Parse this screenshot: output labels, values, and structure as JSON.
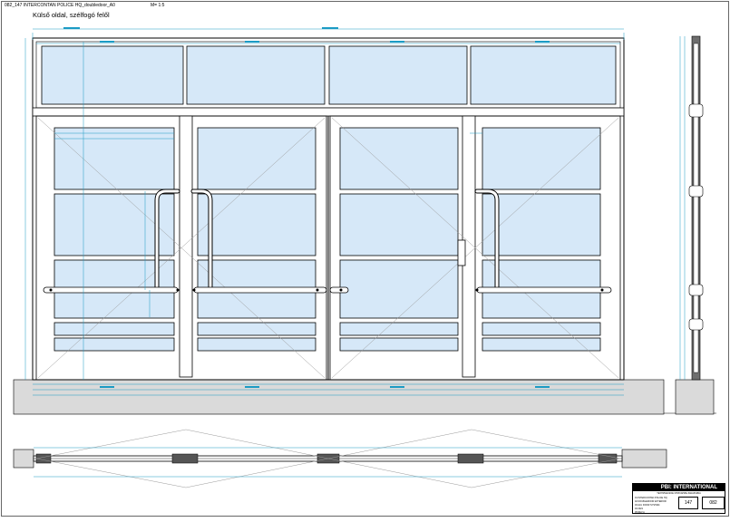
{
  "header": {
    "drawing_id": "082_147  INTERCONTAN POLICE HQ_doubledoor_A0",
    "scale": "M= 1:5"
  },
  "view_title": "Külső oldal, szélfogó felől",
  "title_block": {
    "firm": "PBI: INTERNATIONAL",
    "subtitle": "ТЕХНИЧЕСКОЕ ОПИСАНИЕ ЗАКАЗЧИКА",
    "drawing_number": "147",
    "project_number": "082",
    "rows": [
      "01  INTERCONTAN POLICE HQ",
      "02  DOUBLEDOOR  EXTERIOR",
      "03  ALU  DOOR  SYSTEM",
      "04  2021",
      "05  REV A"
    ]
  },
  "colors": {
    "glass": "#d6e8f8",
    "dim": "#1b9bc4",
    "concrete": "#dadada",
    "line": "#000000",
    "hatch": "#9a9a9a"
  }
}
